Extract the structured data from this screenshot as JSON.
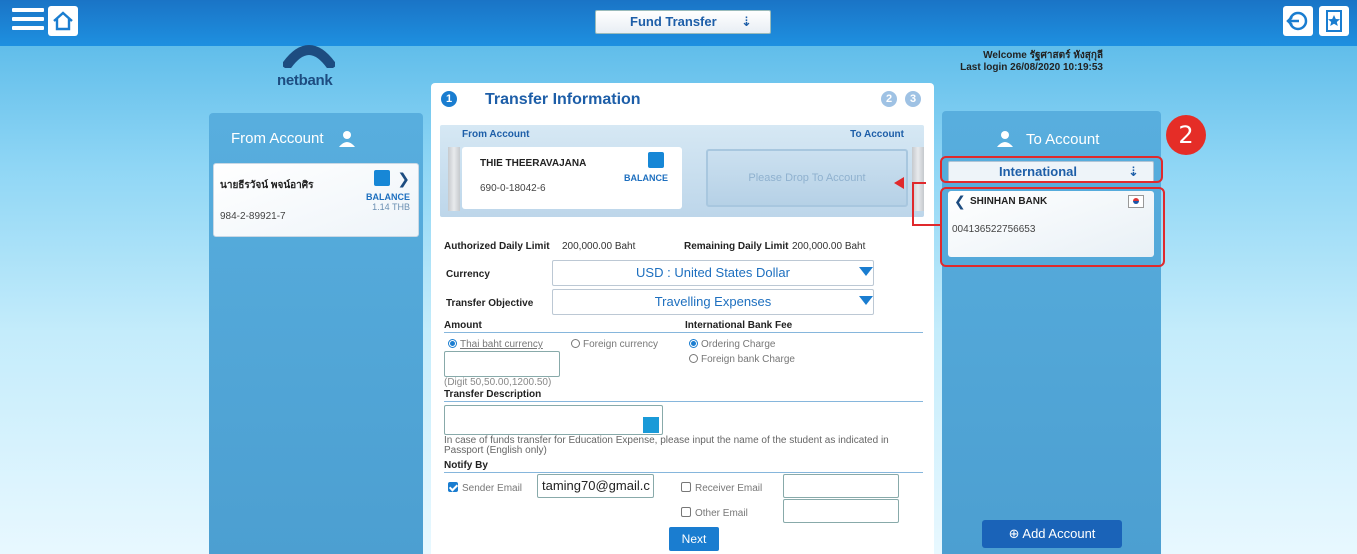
{
  "topbar": {
    "title": "Fund Transfer",
    "chevron": "»"
  },
  "logo": {
    "small": "ktb",
    "word": "netbank"
  },
  "welcome": {
    "line1": "Welcome รัฐศาสตร์ หังสุกุลี",
    "line2": "Last login 26/08/2020 10:19:53"
  },
  "from_panel": {
    "title": "From Account",
    "account": {
      "name": "นายธีรวัจน์ พจน์อาศิร",
      "number": "984-2-89921-7",
      "balance_label": "BALANCE",
      "balance_value": "1.14 THB"
    }
  },
  "center": {
    "steps": [
      "1",
      "2",
      "3"
    ],
    "title": "Transfer Information",
    "from_label": "From Account",
    "to_label": "To Account",
    "from_card": {
      "name": "THIE THEERAVAJANA",
      "balance_label": "BALANCE",
      "number": "690-0-18042-6"
    },
    "drop_placeholder": "Please Drop To Account",
    "auth_limit_label": "Authorized Daily Limit",
    "auth_limit_value": "200,000.00 Baht",
    "remain_limit_label": "Remaining Daily Limit",
    "remain_limit_value": "200,000.00 Baht",
    "currency_label": "Currency",
    "currency_value": "USD : United States Dollar",
    "objective_label": "Transfer Objective",
    "objective_value": "Travelling Expenses",
    "amount_label": "Amount",
    "fee_label": "International Bank Fee",
    "radio_thai": "Thai baht currency",
    "radio_foreign": "Foreign currency",
    "radio_ordering": "Ordering Charge",
    "radio_foreign_bank": "Foreign bank Charge",
    "digit_hint": "(Digit 50,50.00,1200.50)",
    "desc_label": "Transfer Description",
    "edu_note": "In case of funds transfer for Education Expense, please input the name of the student as indicated in Passport (English only)",
    "notify_label": "Notify By",
    "sender_email_label": "Sender Email",
    "sender_email_value": "taming70@gmail.c",
    "receiver_email_label": "Receiver Email",
    "other_email_label": "Other Email",
    "next_label": "Next"
  },
  "to_panel": {
    "title": "To Account",
    "type_value": "International",
    "card": {
      "bank": "SHINHAN BANK",
      "number": "004136522756653"
    },
    "add_label": "Add Account"
  },
  "annotation": {
    "badge": "2"
  },
  "colors": {
    "brand": "#1a7dd0",
    "highlight": "#e0292c"
  }
}
